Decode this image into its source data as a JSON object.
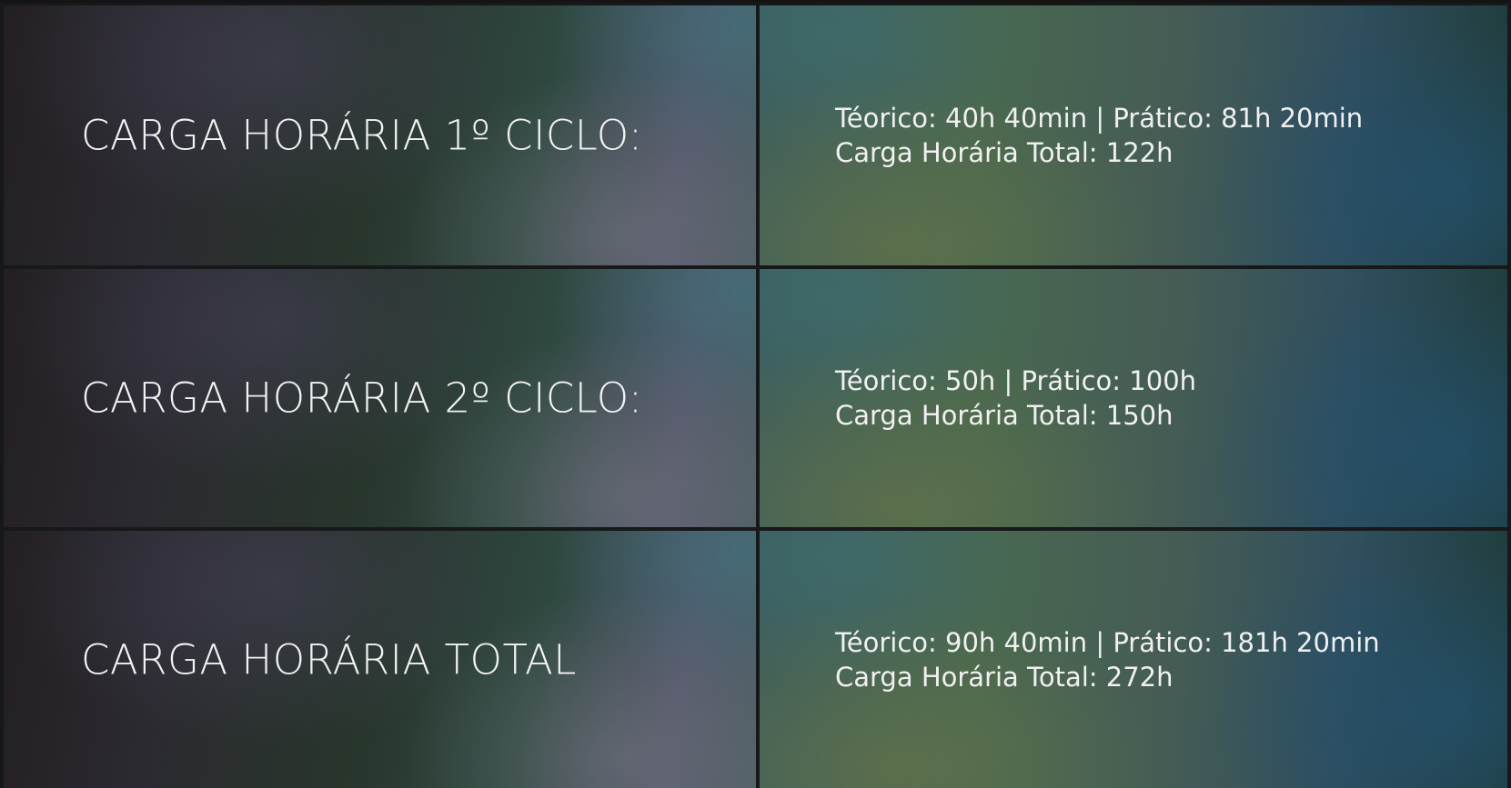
{
  "rows": [
    {
      "title": "CARGA HORÁRIA 1º CICLO:",
      "detail": "Téorico: 40h 40min | Prático: 81h 20min",
      "total": "Carga Horária Total: 122h"
    },
    {
      "title": "CARGA HORÁRIA 2º CICLO:",
      "detail": "Téorico: 50h | Prático: 100h",
      "total": "Carga Horária Total: 150h"
    },
    {
      "title": "CARGA HORÁRIA TOTAL",
      "detail": "Téorico: 90h 40min | Prático: 181h 20min",
      "total": "Carga Horária Total: 272h"
    }
  ],
  "colors": {
    "divider": "#161819",
    "text": "#f2f2f2"
  }
}
